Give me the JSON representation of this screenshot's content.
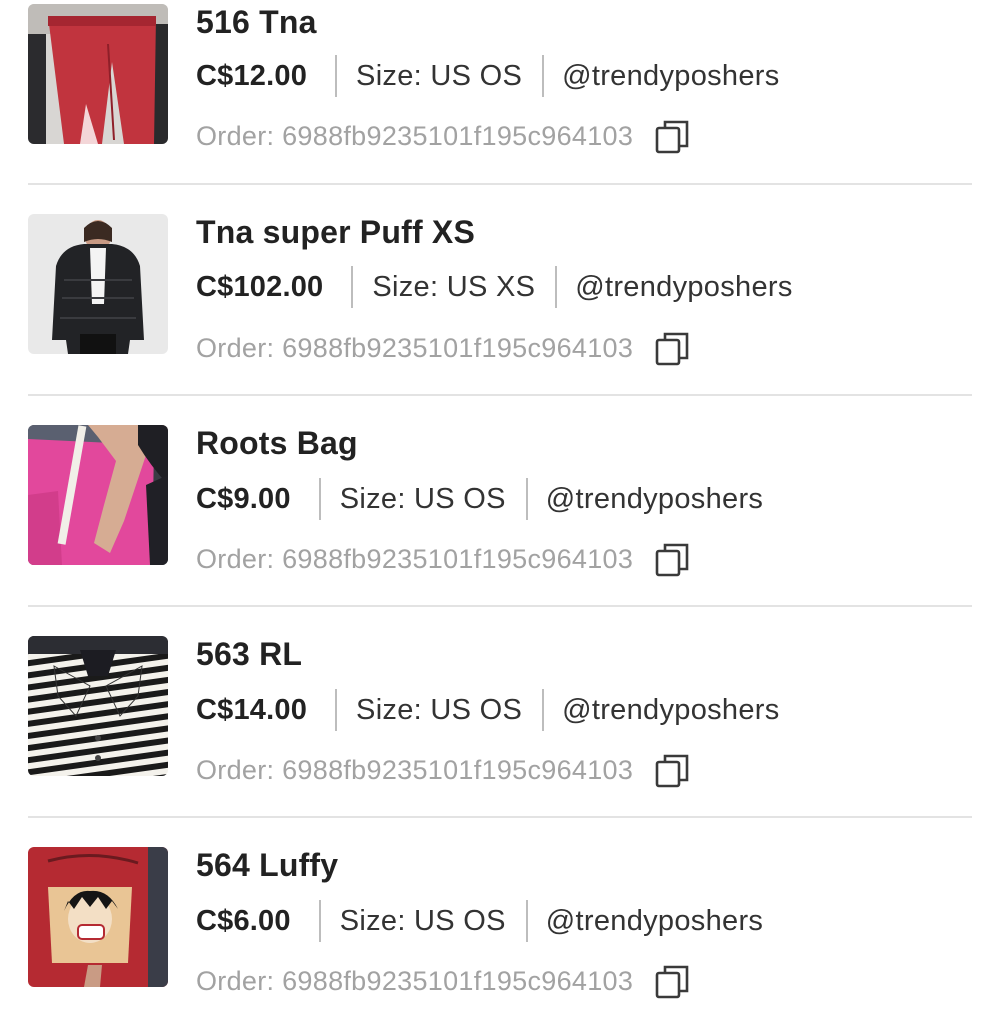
{
  "orders": [
    {
      "title": "516 Tna",
      "price": "C$12.00",
      "size": "Size: US OS",
      "seller": "@trendyposhers",
      "order": "Order: 6988fb9235101f195c964103",
      "thumb": "red-pants-photo"
    },
    {
      "title": "Tna super Puff XS",
      "price": "C$102.00",
      "size": "Size: US XS",
      "seller": "@trendyposhers",
      "order": "Order: 6988fb9235101f195c964103",
      "thumb": "black-puffer-jacket-photo"
    },
    {
      "title": "Roots Bag",
      "price": "C$9.00",
      "size": "Size: US OS",
      "seller": "@trendyposhers",
      "order": "Order: 6988fb9235101f195c964103",
      "thumb": "pink-tote-bag-photo"
    },
    {
      "title": "563 RL",
      "price": "C$14.00",
      "size": "Size: US OS",
      "seller": "@trendyposhers",
      "order": "Order: 6988fb9235101f195c964103",
      "thumb": "striped-blazer-photo"
    },
    {
      "title": "564 Luffy",
      "price": "C$6.00",
      "size": "Size: US OS",
      "seller": "@trendyposhers",
      "order": "Order: 6988fb9235101f195c964103",
      "thumb": "red-anime-shirt-photo"
    }
  ],
  "copy_icon": "copy-icon",
  "colors": {
    "text_primary": "#222222",
    "text_muted": "#a2a2a2",
    "divider": "#e3e3e3"
  }
}
